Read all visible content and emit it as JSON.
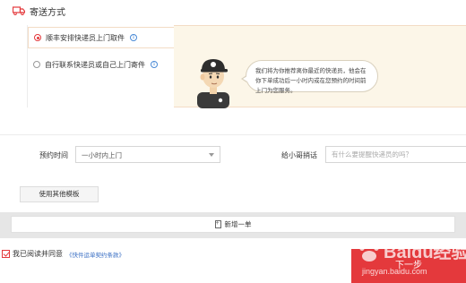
{
  "section": {
    "title": "寄送方式",
    "icon": "truck-icon"
  },
  "delivery_options": [
    {
      "label": "顺丰安排快递员上门取件",
      "selected": true
    },
    {
      "label": "自行联系快递员或自己上门寄件",
      "selected": false
    }
  ],
  "info_message": "我们将为你推荐离你最近的快递员，他会在你下单成功后一小时内或在您预约的时间前上门为您服务。",
  "form": {
    "time_label": "预约时间",
    "time_value": "一小时内上门",
    "message_label": "给小哥捎话",
    "message_placeholder": "有什么要提醒快递员的吗？"
  },
  "template_button_label": "使用其他模板",
  "add_order_label": "新增一单",
  "agreement": {
    "text": "我已阅读并同意",
    "terms_link": "《快件运单契约条款》",
    "checked": true
  },
  "submit_label": "下一步",
  "watermark": {
    "text": "Baidu经验",
    "subtext": "jingyan.baidu.com"
  },
  "colors": {
    "accent": "#e4393c",
    "link": "#3a6fc4",
    "info_bg": "#fcf6e8"
  }
}
